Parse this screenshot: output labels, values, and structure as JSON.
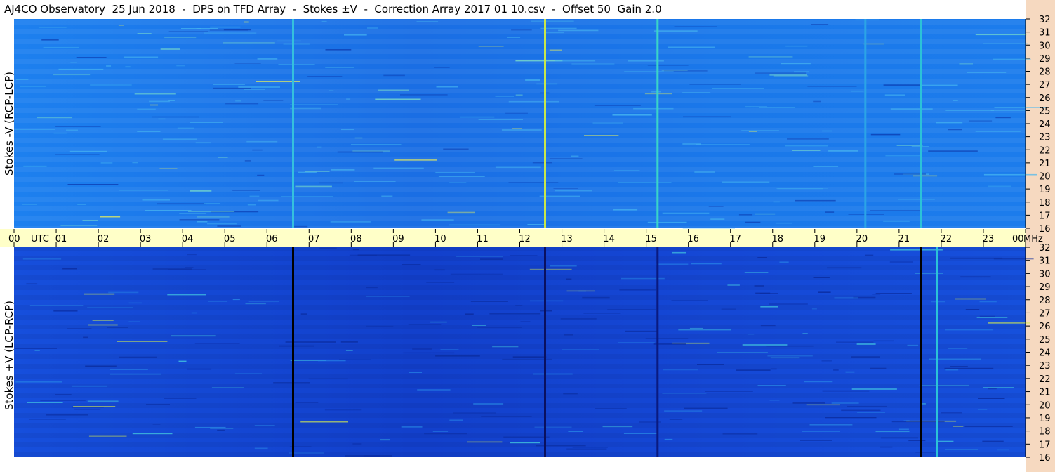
{
  "title": "AJ4CO Observatory  25 Jun 2018  -  DPS on TFD Array  -  Stokes ±V  -  Correction Array 2017 01 10.csv  -  Offset 50  Gain 2.0",
  "chart_data": [
    {
      "type": "heatmap",
      "panel": "top",
      "ylabel": "Stokes -V (RCP-LCP)",
      "x_unit": "UTC",
      "y_unit": "MHz",
      "xlim": [
        0,
        24
      ],
      "ylim": [
        16,
        32
      ],
      "colormap": "blue-cyan-yellow",
      "background_color": "#1a73e8",
      "vertical_lines": [
        {
          "x": 6.62,
          "color": "#35c0dd"
        },
        {
          "x": 12.6,
          "color": "#c8e64a"
        },
        {
          "x": 15.27,
          "color": "#3ad4c8"
        },
        {
          "x": 20.2,
          "color": "#2ba4e6"
        },
        {
          "x": 21.52,
          "color": "#2bc2d8"
        }
      ]
    },
    {
      "type": "heatmap",
      "panel": "bottom",
      "ylabel": "Stokes +V (LCP-RCP)",
      "x_unit": "UTC",
      "y_unit": "MHz",
      "xlim": [
        0,
        24
      ],
      "ylim": [
        16,
        32
      ],
      "colormap": "blue-cyan-yellow",
      "background_color": "#1347d6",
      "vertical_lines": [
        {
          "x": 6.62,
          "color": "#000000"
        },
        {
          "x": 12.6,
          "color": "#0a1060"
        },
        {
          "x": 15.27,
          "color": "#0a1a80"
        },
        {
          "x": 21.52,
          "color": "#000000"
        },
        {
          "x": 21.9,
          "color": "#2bc2d8"
        }
      ]
    }
  ],
  "x_axis": {
    "band_color": "#ffffc8",
    "ticks": [
      "00",
      "01",
      "02",
      "03",
      "04",
      "05",
      "06",
      "07",
      "08",
      "09",
      "10",
      "11",
      "12",
      "13",
      "14",
      "15",
      "16",
      "17",
      "18",
      "19",
      "20",
      "21",
      "22",
      "23",
      "00"
    ],
    "unit_left": "UTC",
    "unit_right": "MHz"
  },
  "y_axis": {
    "ticks": [
      "16",
      "17",
      "18",
      "19",
      "20",
      "21",
      "22",
      "23",
      "24",
      "25",
      "26",
      "27",
      "28",
      "29",
      "30",
      "31",
      "32"
    ]
  }
}
